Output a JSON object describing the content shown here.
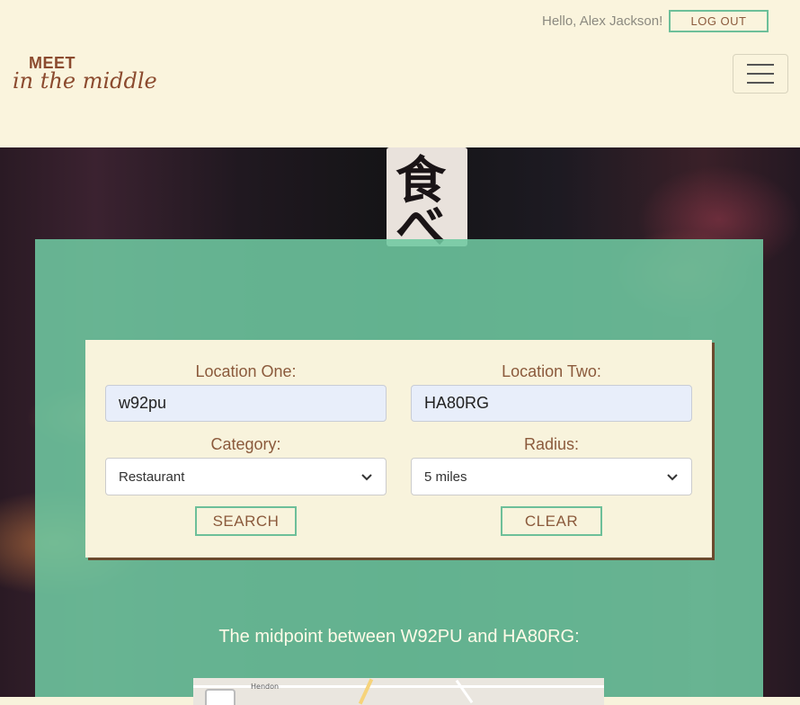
{
  "header": {
    "greeting": "Hello, Alex Jackson!",
    "logout_label": "LOG OUT",
    "logo": {
      "line1": "MEET",
      "line2": "in the middle"
    }
  },
  "hero": {
    "sign_chars": [
      "食",
      "べ"
    ]
  },
  "form": {
    "location_one": {
      "label": "Location One:",
      "value": "w92pu"
    },
    "location_two": {
      "label": "Location Two:",
      "value": "HA80RG"
    },
    "category": {
      "label": "Category:",
      "selected": "Restaurant"
    },
    "radius": {
      "label": "Radius:",
      "selected": "5 miles"
    },
    "search_label": "SEARCH",
    "clear_label": "CLEAR"
  },
  "result": {
    "midpoint_text": "The midpoint between W92PU and HA80RG:"
  },
  "map": {
    "place_label": "Hendon"
  },
  "colors": {
    "header_bg": "#faf4dd",
    "accent_green": "#6dbf99",
    "brand_brown": "#8b5a3c",
    "panel_green": "#6ec8a0"
  }
}
